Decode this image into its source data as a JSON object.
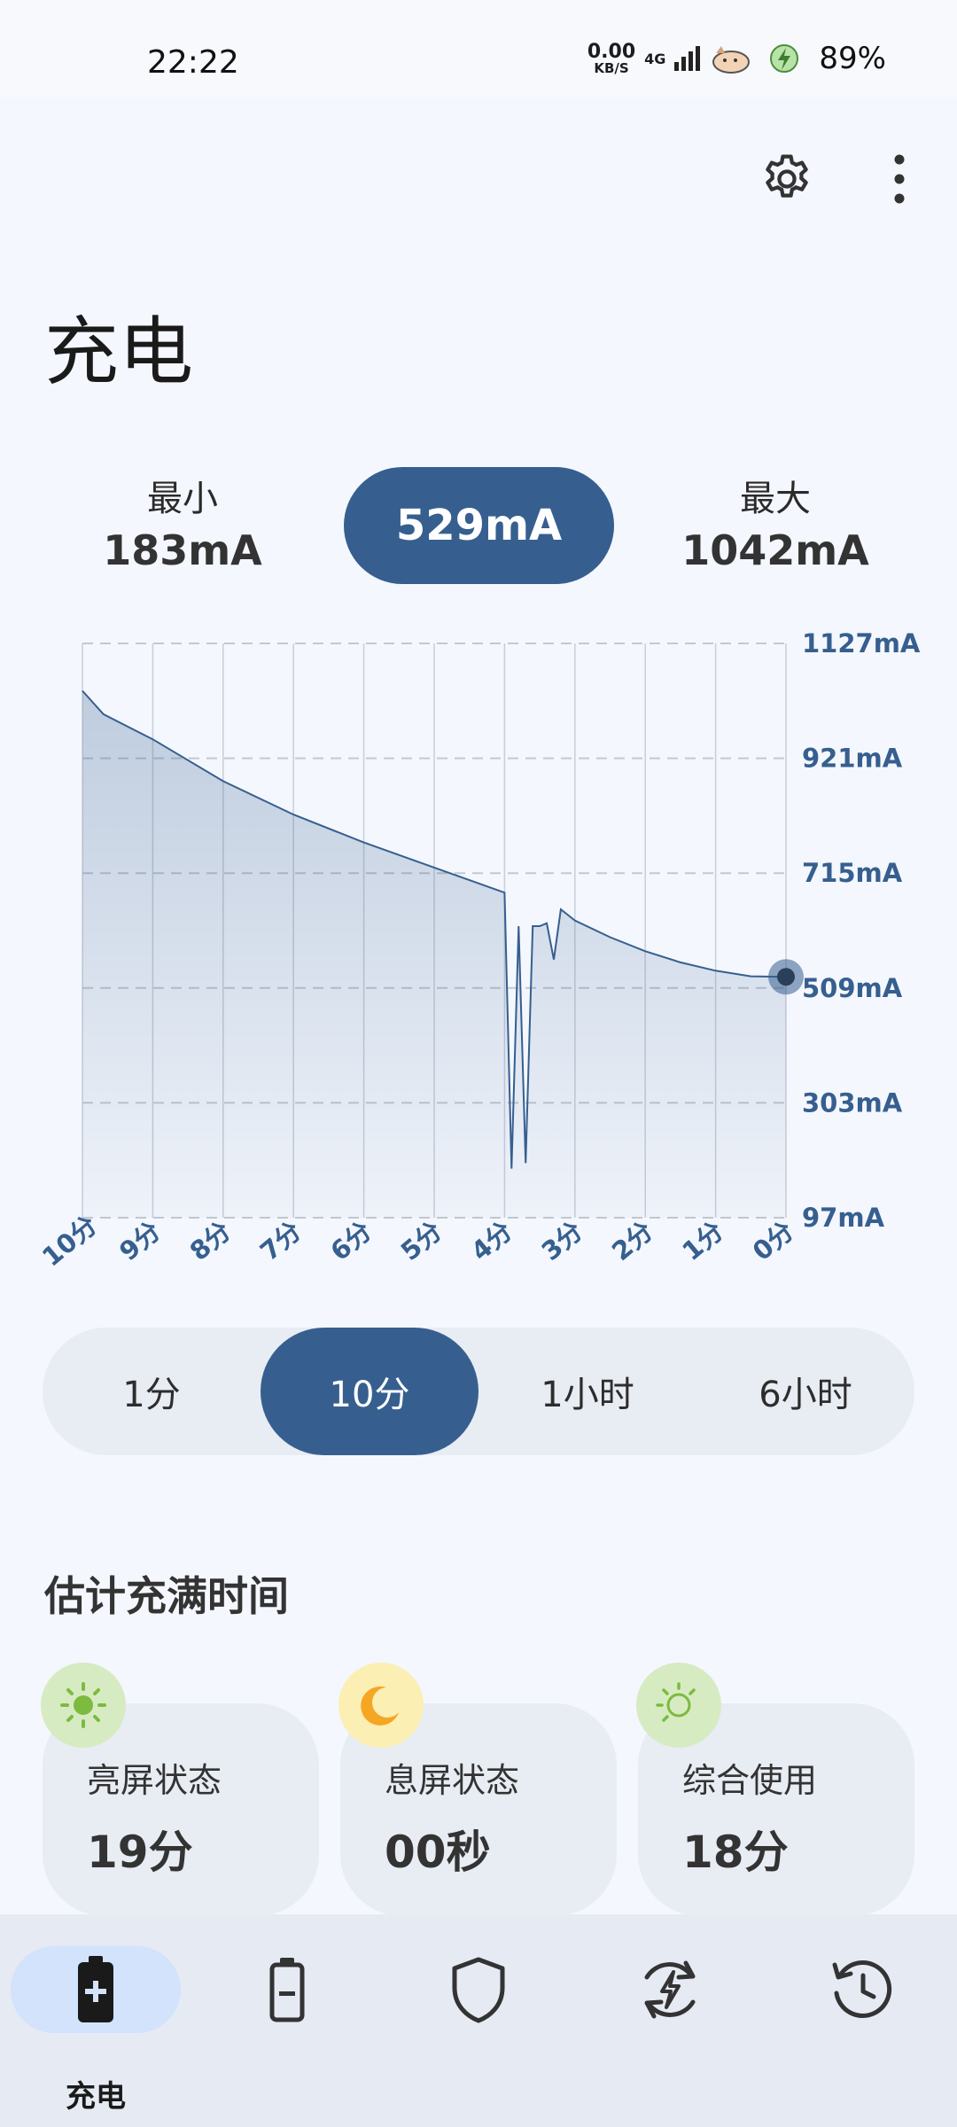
{
  "status_bar": {
    "time": "22:22",
    "net_speed": "0.00",
    "net_unit": "KB/S",
    "network": "4G",
    "battery": "89%"
  },
  "header": {
    "settings_icon": "gear-icon",
    "more_icon": "more-vert-icon",
    "title": "充电"
  },
  "stats": {
    "min_label": "最小",
    "min_value": "183mA",
    "current_value": "529mA",
    "max_label": "最大",
    "max_value": "1042mA"
  },
  "chart_data": {
    "type": "area",
    "xlabel": "",
    "ylabel": "",
    "x_unit": "分钟前",
    "x": [
      10,
      9.7,
      9,
      8,
      7,
      6,
      5,
      4,
      3.9,
      3.8,
      3.7,
      3.6,
      3.5,
      3.4,
      3.3,
      3.2,
      3.1,
      3.0,
      2.5,
      2.0,
      1.5,
      1.0,
      0.5,
      0
    ],
    "values": [
      1042,
      1000,
      955,
      880,
      820,
      770,
      725,
      680,
      185,
      620,
      195,
      620,
      620,
      625,
      560,
      650,
      640,
      630,
      600,
      575,
      555,
      540,
      530,
      529
    ],
    "y_ticks": [
      "1127mA",
      "921mA",
      "715mA",
      "509mA",
      "303mA",
      "97mA"
    ],
    "ylim": [
      97,
      1127
    ],
    "x_ticks": [
      "10分",
      "9分",
      "8分",
      "7分",
      "6分",
      "5分",
      "4分",
      "3分",
      "2分",
      "1分",
      "0分"
    ],
    "series_color": "#365f8f"
  },
  "range_tabs": {
    "items": [
      "1分",
      "10分",
      "1小时",
      "6小时"
    ],
    "selected": "10分"
  },
  "estimate": {
    "title": "估计充满时间",
    "cards": [
      {
        "label": "亮屏状态",
        "value": "19分",
        "icon": "sun-icon",
        "badge_color": "#d7ebc3"
      },
      {
        "label": "息屏状态",
        "value": "00秒",
        "icon": "moon-icon",
        "badge_color": "#fbefb4"
      },
      {
        "label": "综合使用",
        "value": "18分",
        "icon": "mixed-sun-moon-icon",
        "badge_color": "#d7ebc3"
      }
    ]
  },
  "bottom_nav": {
    "items": [
      {
        "label": "充电",
        "icon": "battery-charging-icon",
        "active": true
      },
      {
        "label": "",
        "icon": "battery-icon",
        "active": false
      },
      {
        "label": "",
        "icon": "shield-icon",
        "active": false
      },
      {
        "label": "",
        "icon": "bolt-cycle-icon",
        "active": false
      },
      {
        "label": "",
        "icon": "history-icon",
        "active": false
      }
    ]
  }
}
